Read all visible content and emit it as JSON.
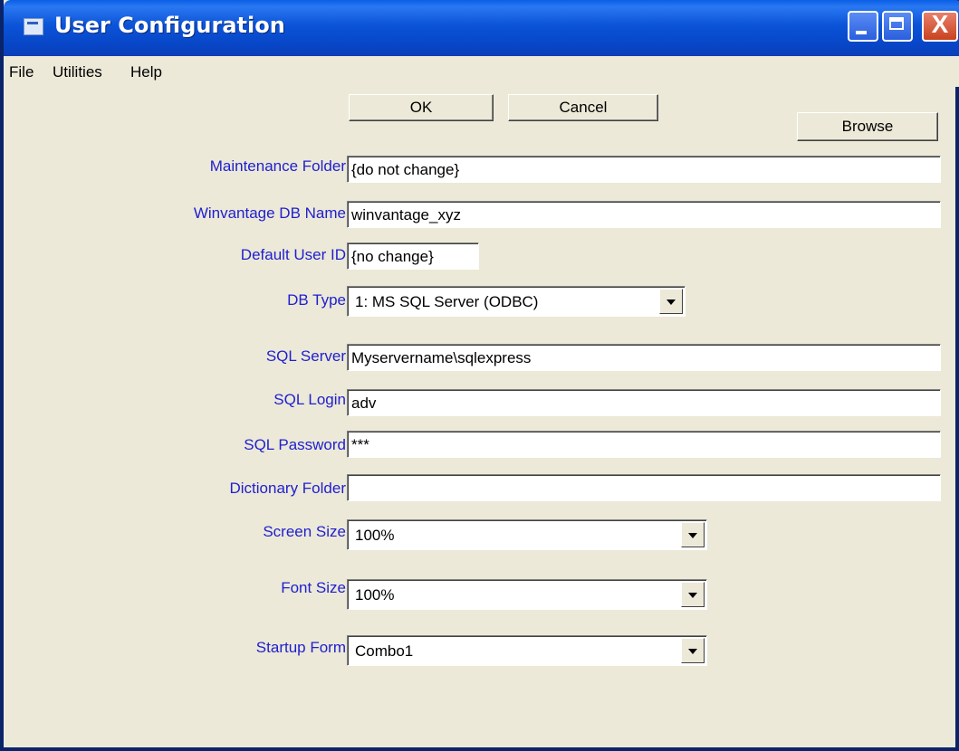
{
  "window": {
    "title": "User Configuration"
  },
  "title_buttons": {
    "close": "X"
  },
  "menu": [
    "File",
    "Utilities",
    "Help"
  ],
  "buttons": {
    "ok": "OK",
    "cancel": "Cancel",
    "browse": "Browse"
  },
  "fields": {
    "maintenance_folder": {
      "label": "Maintenance Folder",
      "value": "{do not change}"
    },
    "db_name": {
      "label": "Winvantage DB Name",
      "value": "winvantage_xyz"
    },
    "default_user_id": {
      "label": "Default User ID",
      "value": "{no change}"
    },
    "db_type": {
      "label": "DB Type",
      "value": "1: MS SQL Server (ODBC)"
    },
    "sql_server": {
      "label": "SQL Server",
      "value": "Myservername\\sqlexpress"
    },
    "sql_login": {
      "label": "SQL Login",
      "value": "adv"
    },
    "sql_password": {
      "label": "SQL Password",
      "value": "***"
    },
    "dictionary_folder": {
      "label": "Dictionary Folder",
      "value": ""
    },
    "screen_size": {
      "label": "Screen Size",
      "value": "100%"
    },
    "font_size": {
      "label": "Font Size",
      "value": "100%"
    },
    "startup_form": {
      "label": "Startup Form",
      "value": "Combo1"
    }
  },
  "colors": {
    "label": "#2020d0",
    "titlebar": "#0b53d8",
    "face": "#ece9d8"
  }
}
